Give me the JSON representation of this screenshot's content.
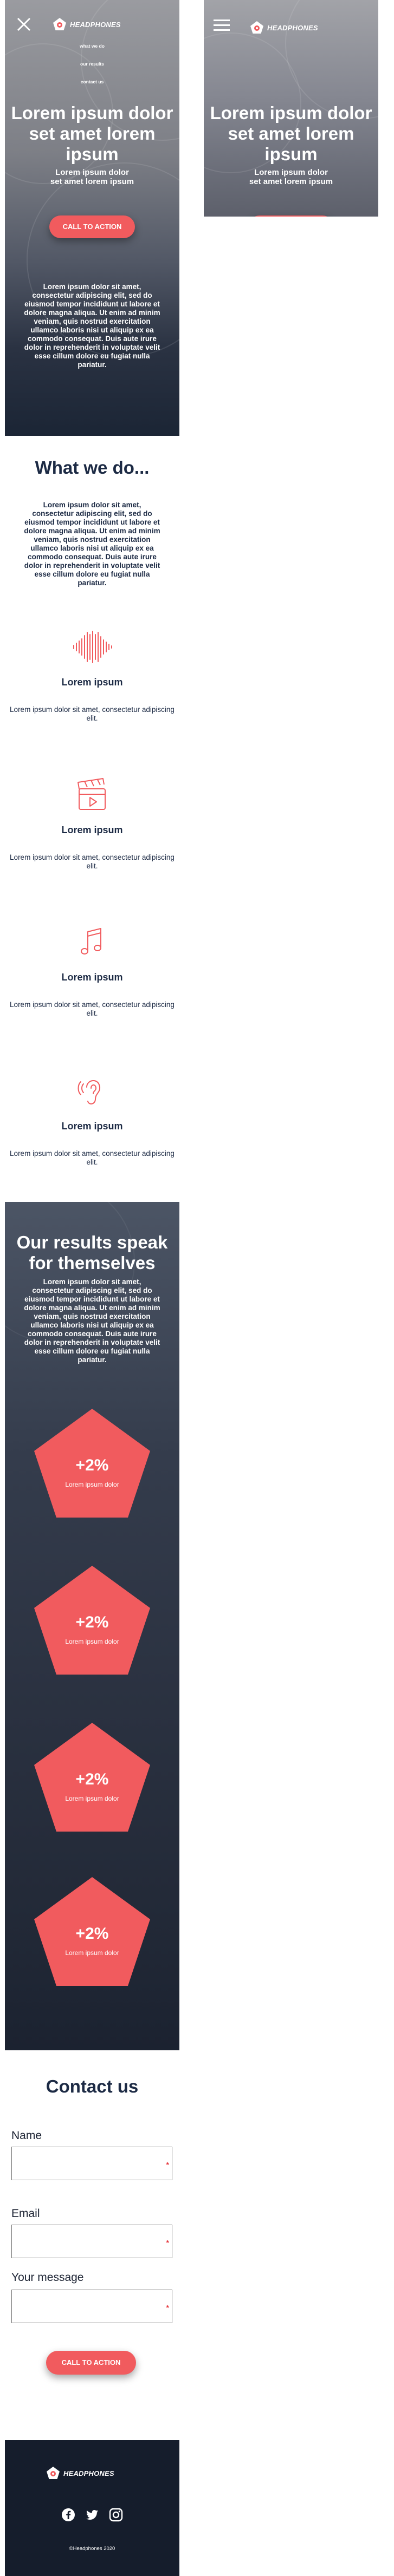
{
  "brand": {
    "name": "HEADPHONES",
    "accent": "#f15b5e",
    "dark": "#151d2c"
  },
  "menu": {
    "items": [
      "what we do",
      "our results",
      "contact us"
    ]
  },
  "hero": {
    "title": "Lorem ipsum dolor set amet lorem ipsum",
    "subtitle": "Lorem ipsum dolor set amet lorem ipsum",
    "cta": "CALL TO ACTION",
    "body": "Lorem ipsum dolor sit amet, consectetur adipiscing elit, sed do eiusmod tempor incididunt ut labore et dolore magna aliqua. Ut enim ad minim veniam, quis nostrud exercitation ullamco laboris nisi ut aliquip ex ea commodo consequat. Duis aute irure dolor in reprehenderit in voluptate velit esse cillum dolore eu fugiat nulla pariatur."
  },
  "what_we_do": {
    "title": "What we do...",
    "body": "Lorem ipsum dolor sit amet, consectetur adipiscing elit, sed do eiusmod tempor incididunt ut labore et dolore magna aliqua. Ut enim ad minim veniam, quis nostrud exercitation ullamco laboris nisi ut aliquip ex ea commodo consequat. Duis aute irure dolor in reprehenderit in voluptate velit esse cillum dolore eu fugiat nulla pariatur.",
    "services": [
      {
        "icon": "soundwave-icon",
        "title": "Lorem ipsum",
        "desc": "Lorem ipsum dolor sit amet, consectetur adipiscing elit."
      },
      {
        "icon": "video-clapper-icon",
        "title": "Lorem ipsum",
        "desc": "Lorem ipsum dolor sit amet, consectetur adipiscing elit."
      },
      {
        "icon": "music-note-icon",
        "title": "Lorem ipsum",
        "desc": "Lorem ipsum dolor sit amet, consectetur adipiscing elit."
      },
      {
        "icon": "ear-icon",
        "title": "Lorem ipsum",
        "desc": "Lorem ipsum dolor sit amet, consectetur adipiscing elit."
      }
    ]
  },
  "results": {
    "title": "Our results speak for themselves",
    "body": "Lorem ipsum dolor sit amet, consectetur adipiscing elit, sed do eiusmod tempor incididunt ut labore et dolore magna aliqua. Ut enim ad minim veniam, quis nostrud exercitation ullamco laboris nisi ut aliquip ex ea commodo consequat. Duis aute irure dolor in reprehenderit in voluptate velit esse cillum dolore eu fugiat nulla pariatur.",
    "stats": [
      {
        "value": "+2%",
        "label": "Lorem ipsum dolor"
      },
      {
        "value": "+2%",
        "label": "Lorem ipsum dolor"
      },
      {
        "value": "+2%",
        "label": "Lorem ipsum dolor"
      },
      {
        "value": "+2%",
        "label": "Lorem ipsum dolor"
      }
    ]
  },
  "contact": {
    "title": "Contact us",
    "fields": [
      {
        "label": "Name",
        "required": "*"
      },
      {
        "label": "Email",
        "required": "*"
      },
      {
        "label": "Your message",
        "required": "*"
      }
    ],
    "cta": "CALL TO ACTION"
  },
  "footer": {
    "social": [
      "facebook-icon",
      "twitter-icon",
      "instagram-icon"
    ],
    "copyright": "©Headphones 2020"
  }
}
